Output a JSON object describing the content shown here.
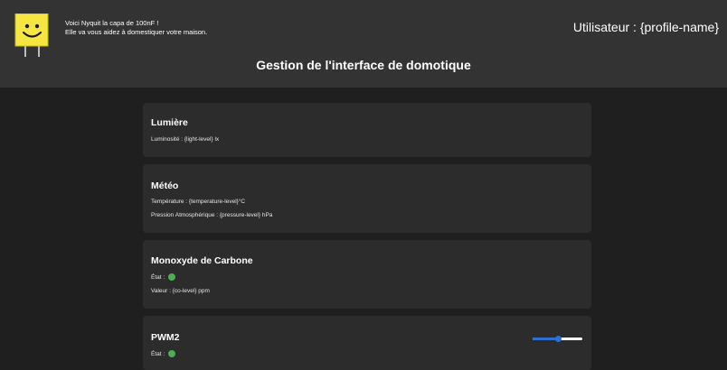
{
  "colors": {
    "header_bg": "#333333",
    "page_bg": "#1f1f1f",
    "card_bg": "#2c2c2c",
    "status_ok": "#4caf50",
    "accent": "#2f6fd1",
    "mascot": "#f5e642"
  },
  "header": {
    "intro_line1": "Voici Nyquit la capa de 100nF !",
    "intro_line2": "Elle va vous aidez à domestiquer votre maison.",
    "user_label": "Utilisateur : {profile-name}",
    "title": "Gestion de l'interface de domotique",
    "mascot_icon": "smiling-capacitor-icon"
  },
  "cards": {
    "light": {
      "title": "Lumière",
      "luminosity": "Luminosité : {light-level} lx"
    },
    "weather": {
      "title": "Météo",
      "temperature": "Température : {temperature-level}°C",
      "pressure": "Pression Atmosphérique : {pressure-level} hPa"
    },
    "co": {
      "title": "Monoxyde de Carbone",
      "state_label": "État :",
      "value": "Valeur : {co-level} ppm"
    },
    "pwm2": {
      "title": "PWM2",
      "state_label": "État :",
      "slider_fraction": 0.5
    }
  }
}
